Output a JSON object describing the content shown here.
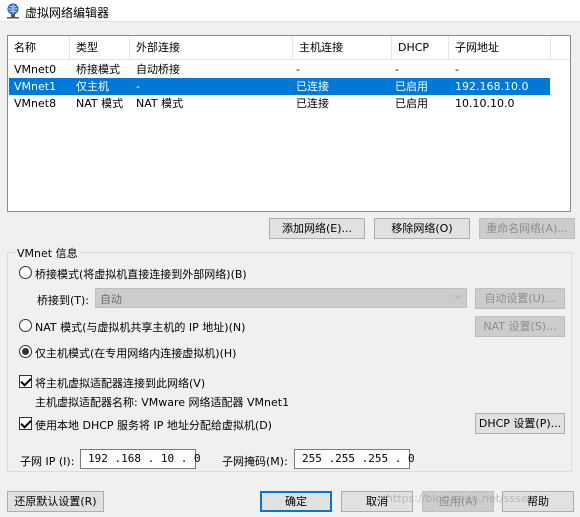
{
  "window": {
    "title": "虚拟网络编辑器"
  },
  "list": {
    "columns": [
      "名称",
      "类型",
      "外部连接",
      "主机连接",
      "DHCP",
      "子网地址"
    ],
    "rows": [
      [
        "VMnet0",
        "桥接模式",
        "自动桥接",
        "-",
        "-",
        "-"
      ],
      [
        "VMnet1",
        "仅主机",
        "-",
        "已连接",
        "已启用",
        "192.168.10.0"
      ],
      [
        "VMnet8",
        "NAT 模式",
        "NAT 模式",
        "已连接",
        "已启用",
        "10.10.10.0"
      ]
    ],
    "selected_index": 1
  },
  "net_buttons": {
    "add": "添加网络(E)...",
    "remove": "移除网络(O)",
    "rename": "重命名网络(A)..."
  },
  "vmnet_info": {
    "title": "VMnet 信息",
    "bridged_label": "桥接模式(将虚拟机直接连接到外部网络)(B)",
    "bridge_to_label": "桥接到(T):",
    "bridge_to_value": "自动",
    "auto_settings": "自动设置(U)...",
    "nat_label": "NAT 模式(与虚拟机共享主机的 IP 地址)(N)",
    "nat_settings": "NAT 设置(S)...",
    "hostonly_label": "仅主机模式(在专用网络内连接虚拟机)(H)",
    "selected_mode": "hostonly",
    "connect_adapter_label": "将主机虚拟适配器连接到此网络(V)",
    "connect_adapter_checked": true,
    "adapter_name_label": "主机虚拟适配器名称: VMware 网络适配器 VMnet1",
    "dhcp_label": "使用本地 DHCP 服务将 IP 地址分配给虚拟机(D)",
    "dhcp_checked": true,
    "dhcp_settings": "DHCP 设置(P)...",
    "subnet_ip_label": "子网 IP (I):",
    "subnet_ip_value": "192 .168 . 10 . 0",
    "subnet_mask_label": "子网掩码(M):",
    "subnet_mask_value": "255 .255 .255 . 0"
  },
  "footer": {
    "restore_defaults": "还原默认设置(R)",
    "ok": "确定",
    "cancel": "取消",
    "apply": "应用(A)",
    "help": "帮助",
    "watermark": "https://blog.csdn.net/sssec"
  },
  "colors": {
    "selection": "#0078d7",
    "background": "#f0f0f0"
  }
}
